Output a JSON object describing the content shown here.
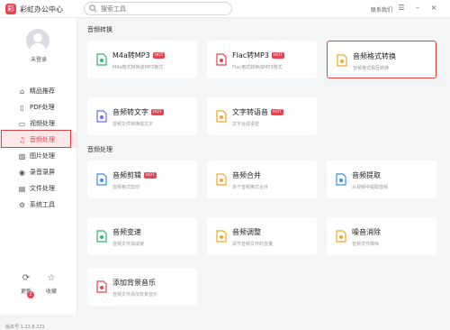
{
  "app": {
    "name": "彩虹办公中心",
    "logo_char": "彩"
  },
  "search": {
    "placeholder": "搜索工具"
  },
  "header": {
    "contact": "联系我们"
  },
  "user": {
    "login": "未登录"
  },
  "sidebar": {
    "items": [
      {
        "label": "精品推荐",
        "icon": "home-icon"
      },
      {
        "label": "PDF处理",
        "icon": "pdf-icon"
      },
      {
        "label": "视频处理",
        "icon": "video-icon"
      },
      {
        "label": "音频处理",
        "icon": "music-icon"
      },
      {
        "label": "图片处理",
        "icon": "image-icon"
      },
      {
        "label": "录音录屏",
        "icon": "record-icon"
      },
      {
        "label": "文件处理",
        "icon": "folder-icon"
      },
      {
        "label": "系统工具",
        "icon": "tools-icon"
      }
    ]
  },
  "footer": {
    "update": "更新",
    "update_badge": "2",
    "favorite": "收藏",
    "version": "版本号:1.22.8.221"
  },
  "sections": {
    "conversion": "音频转换",
    "processing": "音频处理"
  },
  "hot_label": "HOT",
  "cards": [
    {
      "title": "M4a转MP3",
      "desc": "M4a格式转换成MP3格式",
      "hot": true,
      "icon": "m4a-mp3-icon",
      "color": "#2eb872"
    },
    {
      "title": "Flac转MP3",
      "desc": "Flac格式转换成MP3格式",
      "hot": true,
      "icon": "flac-mp3-icon",
      "color": "#e8434f"
    },
    {
      "title": "音频格式转换",
      "desc": "音频格式相互转换",
      "hot": false,
      "icon": "audio-convert-icon",
      "color": "#f5a623"
    },
    {
      "title": "音频转文字",
      "desc": "音频文件转换成文字",
      "hot": true,
      "icon": "audio-text-icon",
      "color": "#6c6cf0"
    },
    {
      "title": "文字转语音",
      "desc": "文字合成语音",
      "hot": true,
      "icon": "text-speech-icon",
      "color": "#f5a623"
    },
    {
      "title": "音频剪辑",
      "desc": "音频格式剪切",
      "hot": true,
      "icon": "audio-cut-icon",
      "color": "#3a8ee6"
    },
    {
      "title": "音频合并",
      "desc": "多个音频格式合并",
      "hot": false,
      "icon": "audio-merge-icon",
      "color": "#f5a623"
    },
    {
      "title": "音频提取",
      "desc": "从视频中提取音频",
      "hot": false,
      "icon": "audio-extract-icon",
      "color": "#3a8ee6"
    },
    {
      "title": "音频变速",
      "desc": "音频文件加减速",
      "hot": false,
      "icon": "audio-speed-icon",
      "color": "#2eb872"
    },
    {
      "title": "音频调整",
      "desc": "调节音频文件的音量",
      "hot": false,
      "icon": "audio-volume-icon",
      "color": "#f5a623"
    },
    {
      "title": "噪音消除",
      "desc": "音频文件降噪",
      "hot": false,
      "icon": "noise-remove-icon",
      "color": "#f5a623"
    },
    {
      "title": "添加背景音乐",
      "desc": "音频文件添加背景音乐",
      "hot": false,
      "icon": "bg-music-icon",
      "color": "#e8434f"
    }
  ]
}
